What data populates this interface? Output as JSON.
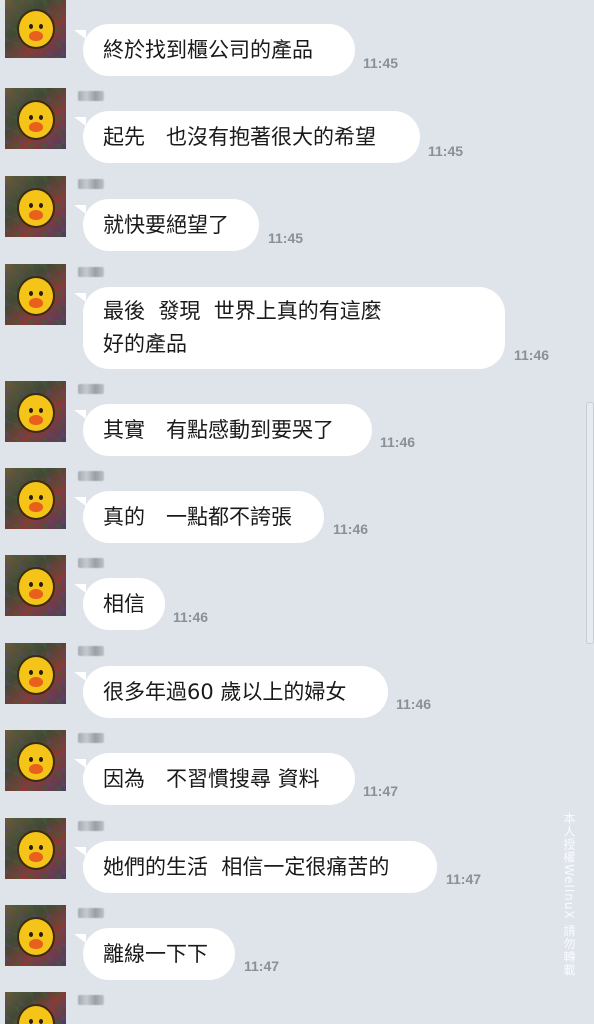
{
  "messages": [
    {
      "text": "終於找到櫃公司的產品",
      "time": "11:45"
    },
    {
      "text": "起先　也沒有抱著很大的希望",
      "time": "11:45"
    },
    {
      "text": "就快要絕望了",
      "time": "11:45"
    },
    {
      "text": "最後  發現  世界上真的有這麼\n好的產品",
      "time": "11:46"
    },
    {
      "text": "其實　有點感動到要哭了",
      "time": "11:46"
    },
    {
      "text": "真的　一點都不誇張",
      "time": "11:46"
    },
    {
      "text": "相信",
      "time": "11:46"
    },
    {
      "text": "很多年過60 歲以上的婦女",
      "time": "11:46"
    },
    {
      "text": "因為　不習慣搜尋 資料",
      "time": "11:47"
    },
    {
      "text": "她們的生活  相信一定很痛苦的",
      "time": "11:47"
    },
    {
      "text": "離線一下下",
      "time": "11:47"
    }
  ],
  "watermark": "本人授權WellnuX 請勿轉載"
}
